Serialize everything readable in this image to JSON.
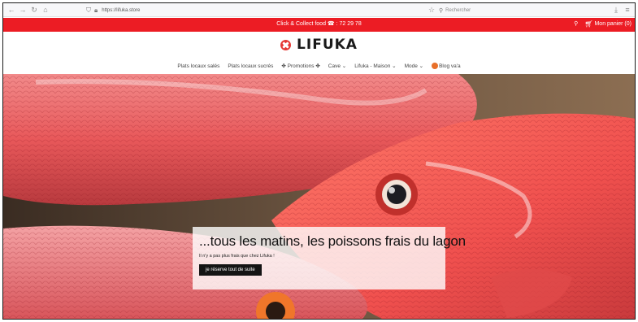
{
  "browser": {
    "url": "https://lifuka.store",
    "search_placeholder": "Rechercher",
    "icons": [
      "back-icon",
      "forward-icon",
      "reload-icon",
      "home-icon",
      "shield-icon",
      "lock-icon",
      "bookmark-star-icon",
      "download-icon",
      "menu-icon"
    ]
  },
  "promo": {
    "text": "Click & Collect food ☎ : 72 29 78",
    "cart_label": "Mon panier (0)"
  },
  "logo": {
    "text": "LIFUKA"
  },
  "nav": {
    "items": [
      "Plats locaux salés",
      "Plats locaux sucrés",
      "✤ Promotions ✤",
      "Cave ⌄",
      "Lifuka - Maison ⌄",
      "Mode ⌄",
      "Blog va'a"
    ]
  },
  "hero": {
    "title": "...tous les matins, les poissons frais du lagon",
    "subtitle": "Il n'y a pas plus frais que chez Lifuka !",
    "button_label": "je réserve tout de suite"
  },
  "colors": {
    "promo_bar": "#ec1c24",
    "logo_mark": "#e53935",
    "button": "#141414"
  }
}
